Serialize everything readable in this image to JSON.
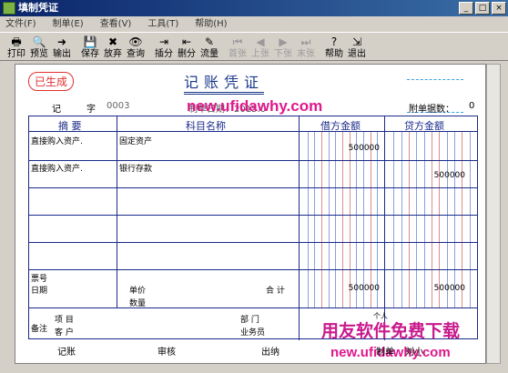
{
  "window": {
    "title": "填制凭证",
    "controls": [
      "_",
      "□",
      "×"
    ]
  },
  "menu": [
    "文件(F)",
    "制单(E)",
    "查看(V)",
    "工具(T)",
    "帮助(H)"
  ],
  "toolbar": [
    {
      "icon": "printer-icon",
      "glyph": "🖶",
      "label": "打印",
      "enabled": true
    },
    {
      "icon": "preview-icon",
      "glyph": "🔍",
      "label": "预览",
      "enabled": true
    },
    {
      "icon": "output-icon",
      "glyph": "➜",
      "label": "输出",
      "enabled": true
    },
    {
      "icon": "save-icon",
      "glyph": "💾",
      "label": "保存",
      "enabled": true
    },
    {
      "icon": "discard-icon",
      "glyph": "✖",
      "label": "放弃",
      "enabled": true
    },
    {
      "icon": "binoculars-icon",
      "glyph": "👁",
      "label": "查询",
      "enabled": true
    },
    {
      "icon": "insert-line-icon",
      "glyph": "⇥",
      "label": "插分",
      "enabled": true
    },
    {
      "icon": "delete-line-icon",
      "glyph": "⇤",
      "label": "删分",
      "enabled": true
    },
    {
      "icon": "flow-icon",
      "glyph": "✎",
      "label": "流量",
      "enabled": true
    },
    {
      "icon": "first-icon",
      "glyph": "⏮",
      "label": "首张",
      "enabled": false
    },
    {
      "icon": "prev-icon",
      "glyph": "◀",
      "label": "上张",
      "enabled": false
    },
    {
      "icon": "next-icon",
      "glyph": "▶",
      "label": "下张",
      "enabled": false
    },
    {
      "icon": "last-icon",
      "glyph": "⏭",
      "label": "末张",
      "enabled": false
    },
    {
      "icon": "help-icon",
      "glyph": "?",
      "label": "帮助",
      "enabled": true
    },
    {
      "icon": "exit-icon",
      "glyph": "⇲",
      "label": "退出",
      "enabled": true
    }
  ],
  "voucher": {
    "stamp": "已生成",
    "title": "记账凭证",
    "type_label": "记",
    "zi_label": "字",
    "number": "0003",
    "date_label": "制单日期：2015.0",
    "attach_label": "附单据数：",
    "attach_value": "0",
    "headers": {
      "summary": "摘  要",
      "subject": "科目名称",
      "debit": "借方金额",
      "credit": "贷方金额"
    },
    "rows": [
      {
        "summary": "直接购入资产.",
        "subject": "固定资产",
        "debit": "500000",
        "credit": ""
      },
      {
        "summary": "直接购入资产.",
        "subject": "银行存款",
        "debit": "",
        "credit": "500000"
      },
      {
        "summary": "",
        "subject": "",
        "debit": "",
        "credit": ""
      },
      {
        "summary": "",
        "subject": "",
        "debit": "",
        "credit": ""
      },
      {
        "summary": "",
        "subject": "",
        "debit": "",
        "credit": ""
      }
    ],
    "bill_no_label": "票号",
    "date2_label": "日期",
    "unit_price_label": "单价",
    "quantity_label": "数量",
    "total_label": "合  计",
    "total_debit": "500000",
    "total_credit": "500000",
    "note_label": "备注",
    "project_label": "项  目",
    "customer_label": "客  户",
    "dept_label": "部  门",
    "salesman_label": "业务员",
    "sign_bookkeeper": "记账",
    "sign_audit": "审核",
    "sign_cashier": "出纳",
    "sign_maker": "制单",
    "maker_name": "刘小",
    "cursor_marker": "个人"
  },
  "watermarks": [
    "new.ufidawhy.com",
    "用友软件免费下载",
    "new.ufidawhy.com"
  ]
}
